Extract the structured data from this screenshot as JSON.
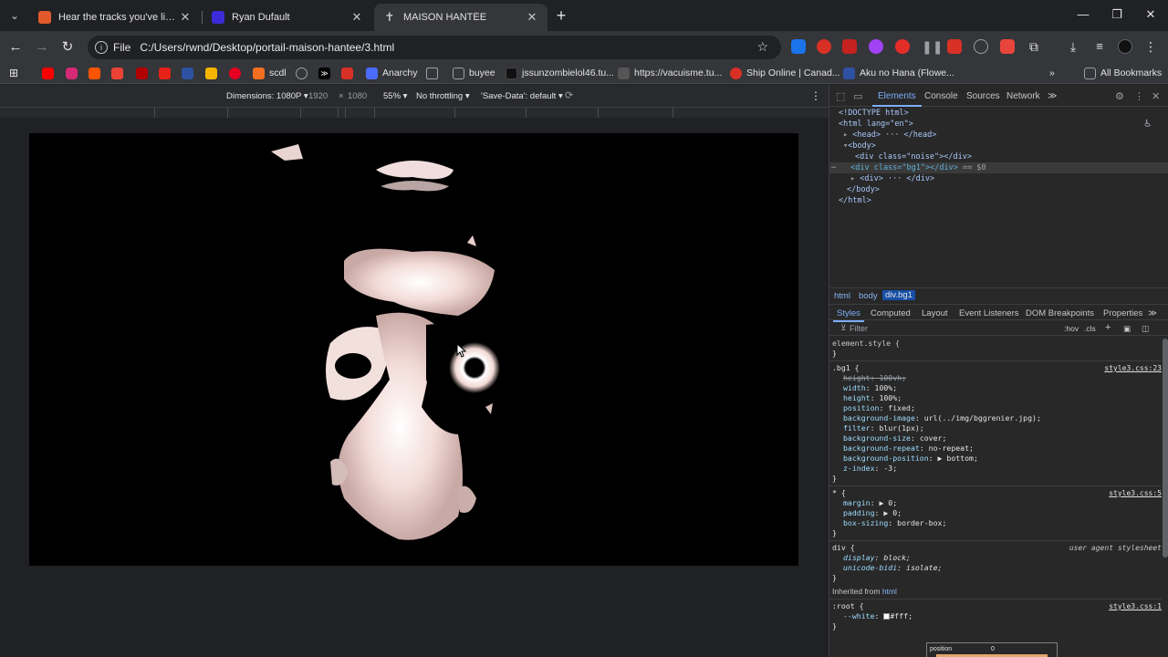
{
  "tabs": [
    {
      "title": "Hear the tracks you've liked: on",
      "color": "#e25a2c"
    },
    {
      "title": "Ryan Dufault",
      "color": "#3b2bd6"
    },
    {
      "title": "MAISON HANTÉE",
      "color": "#c8c8c8"
    }
  ],
  "toolbar": {
    "file_label": "File",
    "url": "C:/Users/rwnd/Desktop/portail-maison-hantee/3.html"
  },
  "bookmarks": [
    {
      "label": "scdl",
      "color": "#f26f21"
    },
    {
      "label": "Anarchy",
      "color": "#4b6bff"
    },
    {
      "label": "buyee",
      "color": "#9aa0a6"
    },
    {
      "label": "jssunzombielol46.tu...",
      "color": "#111111"
    },
    {
      "label": "https://vacuisme.tu...",
      "color": "#555555"
    },
    {
      "label": "Ship Online | Canad...",
      "color": "#d93025"
    },
    {
      "label": "Aku no Hana (Flowe...",
      "color": "#2e51a2"
    },
    {
      "label": "All Bookmarks",
      "color": "#9aa0a6"
    }
  ],
  "device": {
    "dimensions": "Dimensions: 1080P",
    "width": "1920",
    "x": "×",
    "height": "1080",
    "zoom": "55%",
    "throttling": "No throttling",
    "save_data": "'Save-Data': default"
  },
  "devtools": {
    "tabs": [
      "Elements",
      "Console",
      "Sources",
      "Network"
    ],
    "dom": {
      "doctype": "<!DOCTYPE html>",
      "html_open": "<html lang=\"en\">",
      "head": "<head> ··· </head>",
      "body_open": "<body>",
      "noise": "<div class=\"noise\"></div>",
      "bg1": "<div class=\"bg1\"></div>",
      "eq0": "== $0",
      "div": "<div> ··· </div>",
      "body_close": "</body>",
      "html_close": "</html>"
    },
    "breadcrumbs": [
      "html",
      "body",
      "div.bg1"
    ],
    "styles_tabs": [
      "Styles",
      "Computed",
      "Layout",
      "Event Listeners",
      "DOM Breakpoints",
      "Properties"
    ],
    "filter_placeholder": "Filter",
    "filter_right": [
      ":hov",
      ".cls"
    ],
    "rules": {
      "element_style": "element.style {",
      "bg1_selector": ".bg1 {",
      "bg1_source": "style3.css:23",
      "bg1_props": [
        {
          "name": "height",
          "value": "100vh;",
          "struck": true
        },
        {
          "name": "width",
          "value": "100%;"
        },
        {
          "name": "height",
          "value": "100%;"
        },
        {
          "name": "position",
          "value": "fixed;"
        },
        {
          "name": "background-image",
          "value": "url(../img/bggrenier.jpg);"
        },
        {
          "name": "filter",
          "value": "blur(1px);"
        },
        {
          "name": "background-size",
          "value": "cover;"
        },
        {
          "name": "background-repeat",
          "value": "no-repeat;"
        },
        {
          "name": "background-position",
          "value": "▶ bottom;"
        },
        {
          "name": "z-index",
          "value": "-3;"
        }
      ],
      "star_selector": "* {",
      "star_source": "style3.css:5",
      "star_props": [
        {
          "name": "margin",
          "value": "▶ 0;"
        },
        {
          "name": "padding",
          "value": "▶ 0;"
        },
        {
          "name": "box-sizing",
          "value": "border-box;"
        }
      ],
      "div_selector": "div {",
      "div_source": "user agent stylesheet",
      "div_props": [
        {
          "name": "display",
          "value": "block;"
        },
        {
          "name": "unicode-bidi",
          "value": "isolate;"
        }
      ],
      "inherited_label": "Inherited from",
      "inherited_from": "html",
      "root_selector": ":root {",
      "root_source": "style3.css:1",
      "root_props": [
        {
          "name": "--white",
          "value": "#fff;"
        }
      ],
      "close": "}"
    },
    "box_model": {
      "label": "position",
      "value": "0"
    }
  }
}
